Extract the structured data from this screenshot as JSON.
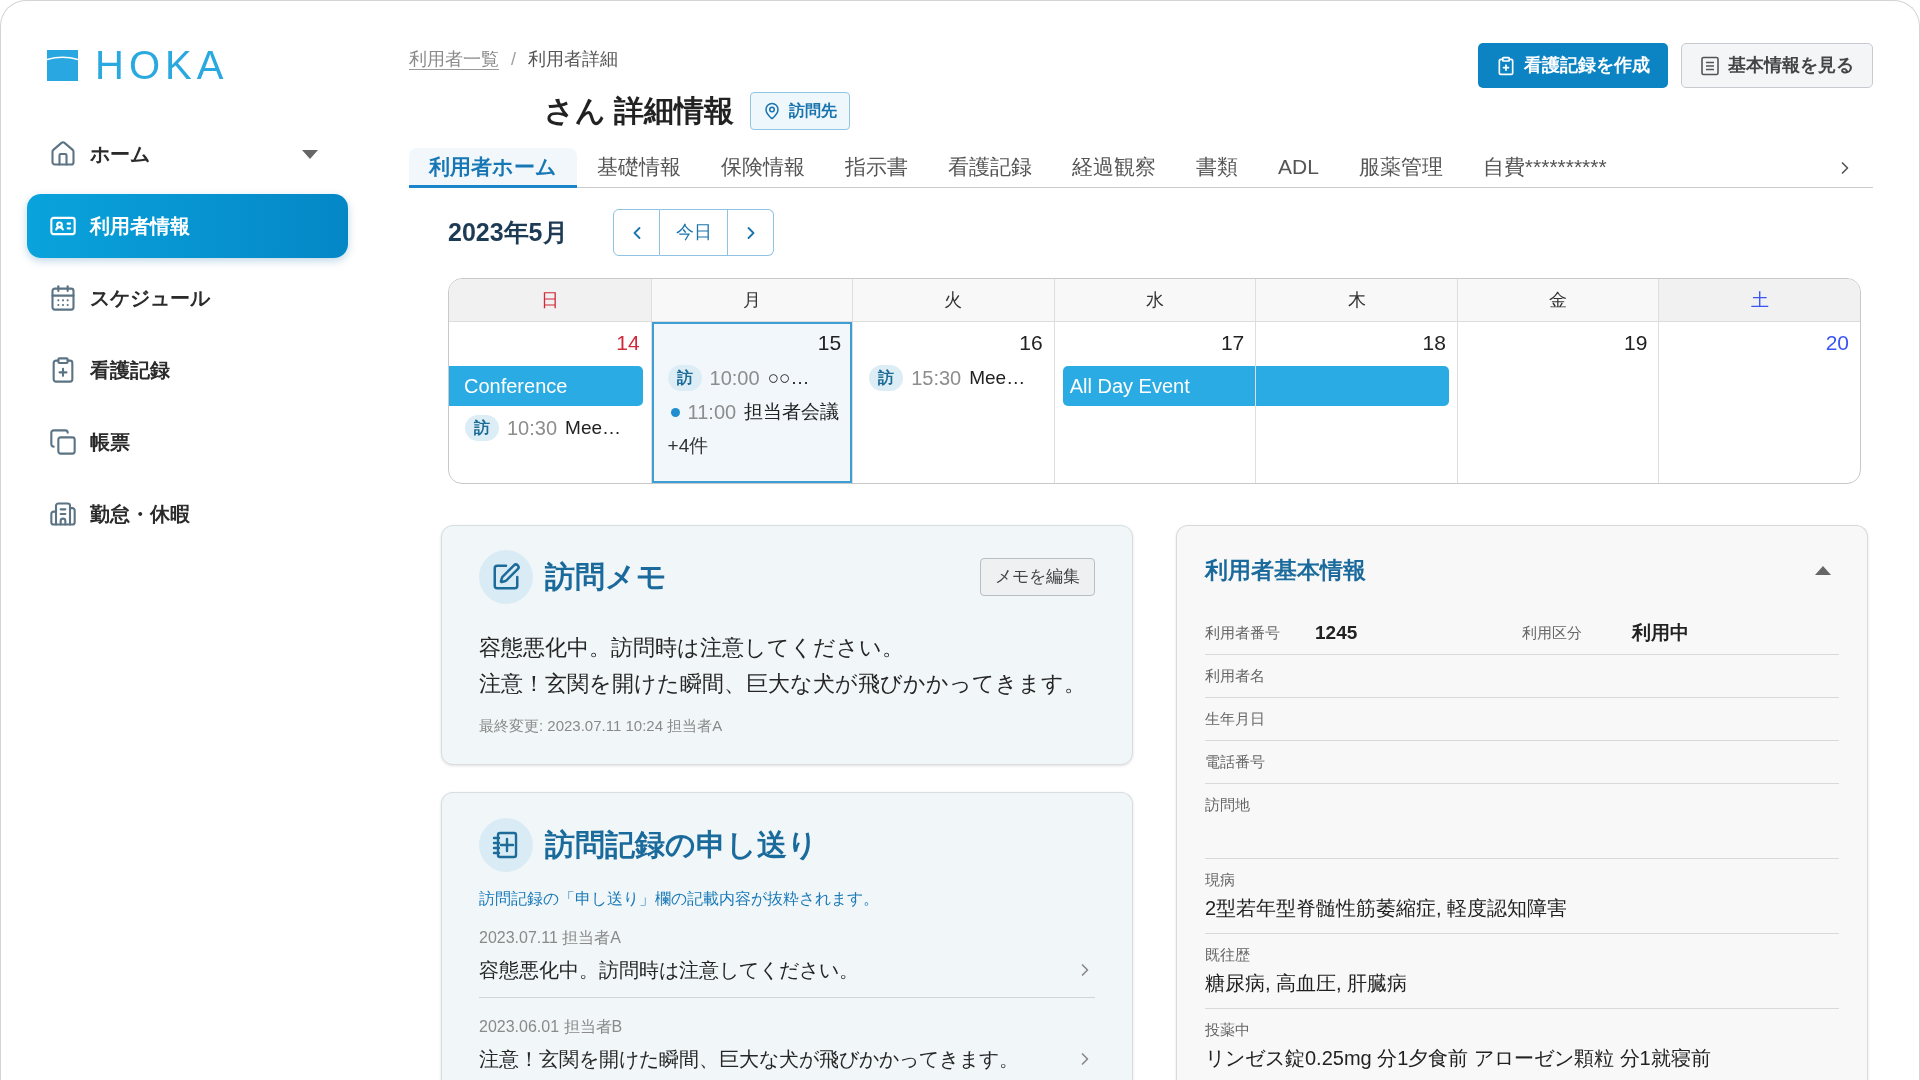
{
  "logo": {
    "text": "HOKA"
  },
  "sidebar": {
    "items": [
      {
        "label": "ホーム",
        "kind": "group",
        "expanded": false,
        "selected": false
      },
      {
        "label": "利用者情報",
        "kind": "link",
        "selected": true
      },
      {
        "label": "スケジュール",
        "kind": "link",
        "selected": false
      },
      {
        "label": "看護記録",
        "kind": "link",
        "selected": false
      },
      {
        "label": "帳票",
        "kind": "link",
        "selected": false
      },
      {
        "label": "勤怠・休暇",
        "kind": "link",
        "selected": false
      }
    ]
  },
  "breadcrumb": {
    "items": [
      {
        "label": "利用者一覧",
        "kind": "link"
      },
      {
        "label": "利用者詳細",
        "kind": "current"
      }
    ],
    "separator": "/"
  },
  "page_title": "さん 詳細情報",
  "title_badge": {
    "label": "訪問先"
  },
  "header_buttons": [
    {
      "label": "看護記録を作成",
      "kind": "primary"
    },
    {
      "label": "基本情報を見る",
      "kind": "secondary"
    }
  ],
  "tabs": [
    {
      "label": "利用者ホーム",
      "selected": true
    },
    {
      "label": "基礎情報",
      "selected": false
    },
    {
      "label": "保険情報",
      "selected": false
    },
    {
      "label": "指示書",
      "selected": false
    },
    {
      "label": "看護記録",
      "selected": false
    },
    {
      "label": "経過観察",
      "selected": false
    },
    {
      "label": "書類",
      "selected": false
    },
    {
      "label": "ADL",
      "selected": false
    },
    {
      "label": "服薬管理",
      "selected": false
    },
    {
      "label": "自費**********",
      "selected": false
    }
  ],
  "calendar": {
    "month": "2023年5月",
    "today_button": "今日",
    "weekdays": [
      {
        "label": "日",
        "kind": "sunday"
      },
      {
        "label": "月",
        "kind": "weekday"
      },
      {
        "label": "火",
        "kind": "weekday"
      },
      {
        "label": "水",
        "kind": "weekday"
      },
      {
        "label": "木",
        "kind": "weekday"
      },
      {
        "label": "金",
        "kind": "weekday"
      },
      {
        "label": "土",
        "kind": "saturday"
      }
    ],
    "days": [
      {
        "date": "14",
        "kind": "sunday",
        "selected": false,
        "all_day": {
          "title": "Conference",
          "starts_here": false,
          "ends_here": true
        },
        "events": [
          {
            "kind": "visit",
            "badge": "訪",
            "time": "10:30",
            "title": "Mee…"
          }
        ]
      },
      {
        "date": "15",
        "kind": "weekday",
        "selected": true,
        "events": [
          {
            "kind": "visit",
            "badge": "訪",
            "time": "10:00",
            "title": "○○…"
          },
          {
            "kind": "dot",
            "time": "11:00",
            "title": "担当者会議"
          }
        ],
        "more": "+4件"
      },
      {
        "date": "16",
        "kind": "weekday",
        "selected": false,
        "events": [
          {
            "kind": "visit",
            "badge": "訪",
            "time": "15:30",
            "title": "Mee…"
          }
        ]
      },
      {
        "date": "17",
        "kind": "weekday",
        "selected": false,
        "all_day": {
          "title": "All Day Event",
          "starts_here": true,
          "ends_here": false
        }
      },
      {
        "date": "18",
        "kind": "weekday",
        "selected": false,
        "all_day": {
          "starts_here": false,
          "ends_here": true
        }
      },
      {
        "date": "19",
        "kind": "weekday",
        "selected": false
      },
      {
        "date": "20",
        "kind": "saturday",
        "selected": false
      }
    ]
  },
  "visit_memo": {
    "title": "訪問メモ",
    "edit_button": "メモを編集",
    "lines": [
      "容態悪化中。訪問時は注意してください。",
      "注意！玄関を開けた瞬間、巨大な犬が飛びかかってきます。"
    ],
    "updated": "最終変更: 2023.07.11 10:24 担当者A"
  },
  "handover": {
    "title": "訪問記録の申し送り",
    "description": "訪問記録の「申し送り」欄の記載内容が抜粋されます。",
    "entries": [
      {
        "meta": "2023.07.11 担当者A",
        "text": "容態悪化中。訪問時は注意してください。"
      },
      {
        "meta": "2023.06.01 担当者B",
        "text": "注意！玄関を開けた瞬間、巨大な犬が飛びかかってきます。"
      }
    ]
  },
  "basic_info": {
    "title": "利用者基本情報",
    "expanded": true,
    "rows": [
      {
        "kind": "pair",
        "fields": [
          {
            "label": "利用者番号",
            "value": "1245"
          },
          {
            "label": "利用区分",
            "value": "利用中"
          }
        ]
      },
      {
        "kind": "inline",
        "label": "利用者名"
      },
      {
        "kind": "inline",
        "label": "生年月日"
      },
      {
        "kind": "inline",
        "label": "電話番号"
      },
      {
        "kind": "stacked",
        "label": "訪問地"
      },
      {
        "kind": "stacked",
        "label": "現病",
        "value": "2型若年型脊髄性筋萎縮症, 軽度認知障害"
      },
      {
        "kind": "stacked",
        "label": "既往歴",
        "value": "糖尿病, 高血圧, 肝臓病"
      },
      {
        "kind": "stacked",
        "label": "投薬中",
        "value": "リンゼス錠0.25mg 分1夕食前 アローゼン顆粒 分1就寝前"
      }
    ]
  }
}
